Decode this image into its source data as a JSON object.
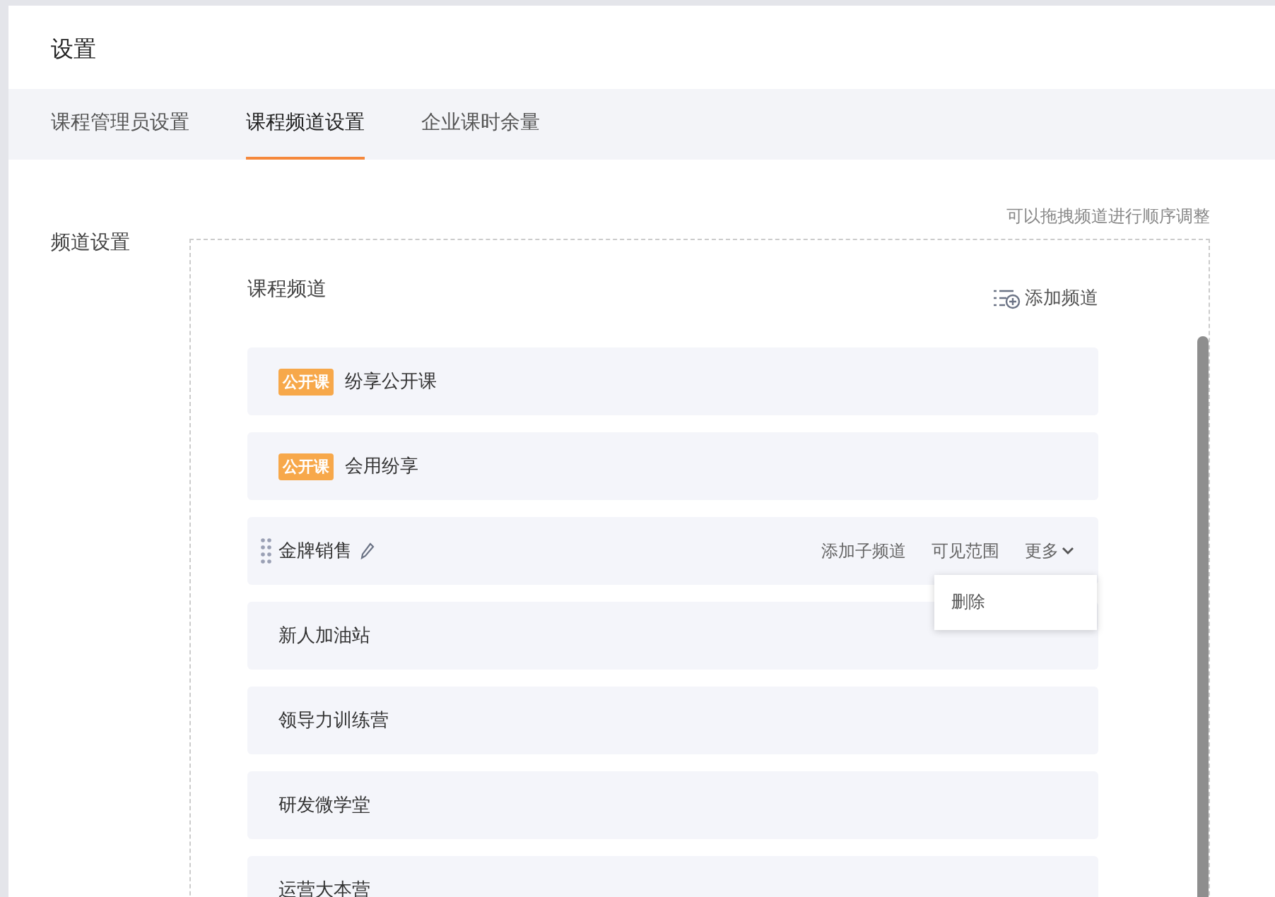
{
  "page": {
    "title": "设置"
  },
  "tabs": [
    {
      "label": "课程管理员设置",
      "selected": false
    },
    {
      "label": "课程频道设置",
      "selected": true
    },
    {
      "label": "企业课时余量",
      "selected": false
    }
  ],
  "section": {
    "label": "频道设置",
    "hint": "可以拖拽频道进行顺序调整"
  },
  "panel": {
    "title": "课程频道",
    "add_button": "添加频道"
  },
  "channels": [
    {
      "name": "纷享公开课",
      "tag": "公开课",
      "active": false
    },
    {
      "name": "会用纷享",
      "tag": "公开课",
      "active": false
    },
    {
      "name": "金牌销售",
      "active": true,
      "actions": [
        "添加子频道",
        "可见范围"
      ],
      "more": {
        "label": "更多",
        "expanded": true,
        "menu": [
          "删除"
        ]
      }
    },
    {
      "name": "新人加油站",
      "active": false
    },
    {
      "name": "领导力训练营",
      "active": false
    },
    {
      "name": "研发微学堂",
      "active": false
    },
    {
      "name": "运营大本营",
      "active": false
    }
  ]
}
